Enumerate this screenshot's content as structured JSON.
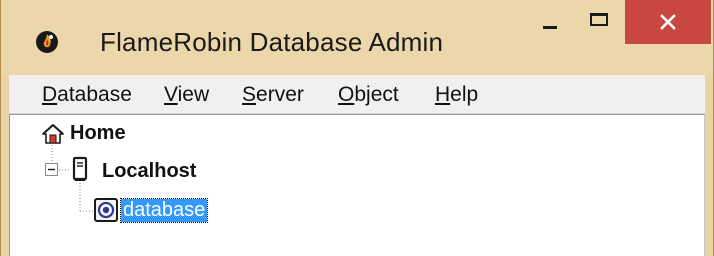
{
  "window": {
    "title": "FlameRobin Database Admin",
    "frame_color": "#ecd7ab",
    "close_button_color": "#c8473f"
  },
  "titlebar_icons": {
    "app": "flamerobin-logo-icon",
    "minimize": "minimize-icon",
    "maximize": "maximize-icon",
    "close": "close-icon"
  },
  "menu": {
    "items": [
      {
        "accel": "D",
        "rest": "atabase"
      },
      {
        "accel": "V",
        "rest": "iew"
      },
      {
        "accel": "S",
        "rest": "erver"
      },
      {
        "accel": "O",
        "rest": "bject"
      },
      {
        "accel": "H",
        "rest": "elp"
      }
    ]
  },
  "tree": {
    "home": {
      "label": "Home",
      "icon": "home-icon"
    },
    "server": {
      "label": "Localhost",
      "icon": "server-icon",
      "expander": "collapse-minus-icon"
    },
    "database": {
      "label": "database",
      "icon": "database-icon",
      "selected": true
    }
  },
  "colors": {
    "selection": "#3399ff",
    "menu_background": "#f0f0f0",
    "tree_background": "#ffffff"
  }
}
